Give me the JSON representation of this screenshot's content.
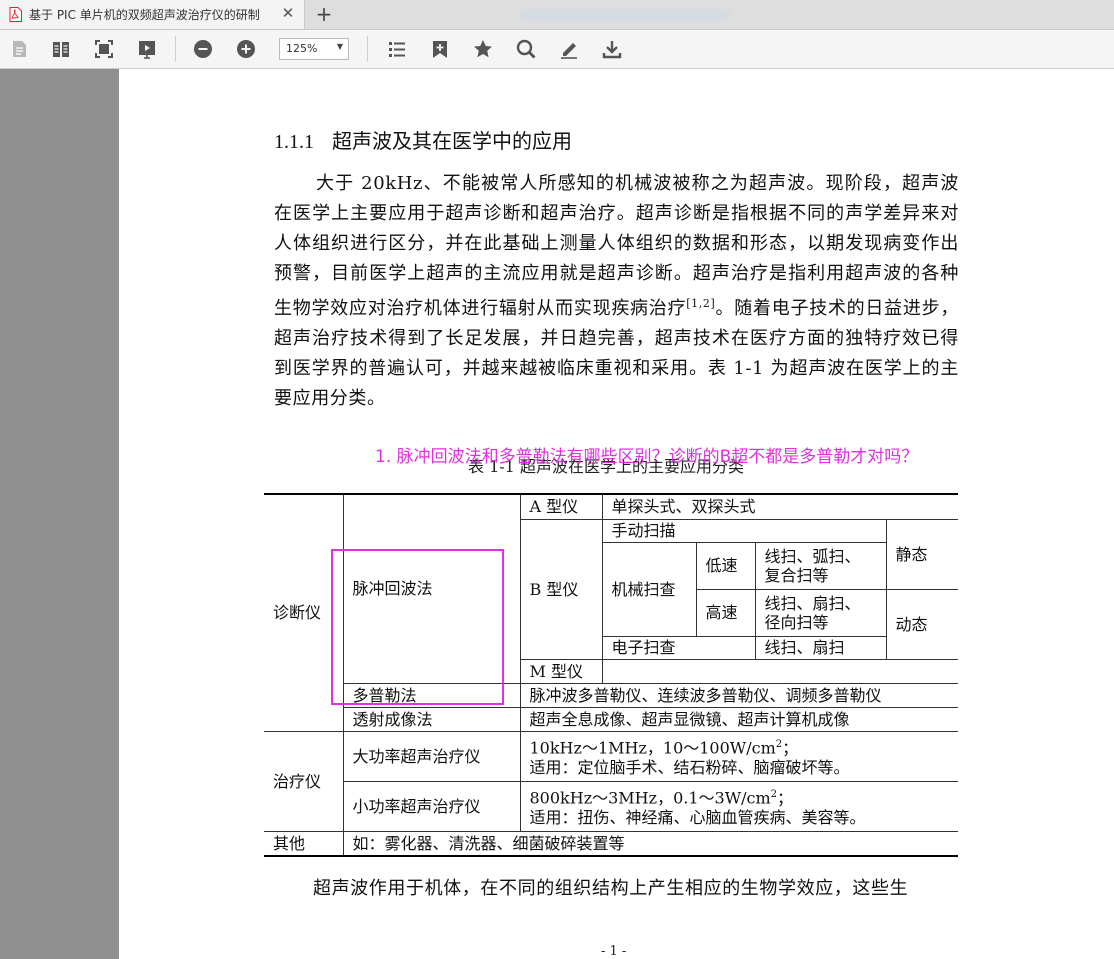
{
  "tab": {
    "title": "基于 PIC 单片机的双频超声波治疗仪的研制",
    "close": "✕",
    "new_tab": "+"
  },
  "toolbar": {
    "zoom": "125%",
    "icons": [
      "page-icon",
      "two-page-icon",
      "fit-page-icon",
      "presentation-icon",
      "zoom-out-icon",
      "zoom-in-icon",
      "outline-list-icon",
      "add-bookmark-icon",
      "star-icon",
      "search-icon",
      "annotate-pen-icon",
      "download-icon"
    ]
  },
  "doc": {
    "heading_num": "1.1.1",
    "heading_text": "超声波及其在医学中的应用",
    "para1_a": "大于 20kHz、不能被常人所感知的机械波被称之为超声波。现阶段，超声波在医学上主要应用于超声诊断和超声治疗。超声诊断是指根据不同的声学差异来对人体组织进行区分，并在此基础上测量人体组织的数据和形态，以期发现病变作出预警，目前医学上超声的主流应用就是超声诊断。超声治疗是指利用超声波的各种生物学效应对治疗机体进行辐射从而实现疾病治疗",
    "para1_sup": "[1,2]",
    "para1_b": "。随着电子技术的日益进步，超声治疗技术得到了长足发展，并日趋完善，超声技术在医疗方面的独特疗效已得到医学界的普遍认可，并越来越被临床重视和采用。表 1-1 为超声波在医学上的主要应用分类。",
    "annotation": "1. 脉冲回波法和多普勒法有哪些区别？诊断的B超不都是多普勒才对吗？",
    "caption": "表 1-1  超声波在医学上的主要应用分类",
    "para2": "超声波作用于机体，在不同的组织结构上产生相应的生物学效应，这些生",
    "page_number": "- 1 -"
  },
  "table": {
    "diag": "诊断仪",
    "pulse": "脉冲回波法",
    "a_type": "A 型仪",
    "a_desc": "单探头式、双探头式",
    "b_type": "B 型仪",
    "manual": "手动扫描",
    "mech": "机械扫查",
    "low": "低速",
    "low_desc_1": "线扫、弧扫、",
    "low_desc_2": "复合扫等",
    "static": "静态",
    "high": "高速",
    "high_desc_1": "线扫、扇扫、",
    "high_desc_2": "径向扫等",
    "dynamic": "动态",
    "elec": "电子扫查",
    "elec_desc": "线扫、扇扫",
    "m_type": "M 型仪",
    "doppler": "多普勒法",
    "doppler_desc": "脉冲波多普勒仪、连续波多普勒仪、调频多普勒仪",
    "trans": "透射成像法",
    "trans_desc": "超声全息成像、超声显微镜、超声计算机成像",
    "treat": "治疗仪",
    "hp": "大功率超声治疗仪",
    "hp_line1_a": "10kHz～1MHz，10～100W/cm",
    "hp_line1_b": "；",
    "hp_line2": "适用：定位脑手术、结石粉碎、脑瘤破坏等。",
    "lp": "小功率超声治疗仪",
    "lp_line1_a": "800kHz～3MHz，0.1～3W/cm",
    "lp_line1_b": "；",
    "lp_line2": "适用：扭伤、神经痛、心脑血管疾病、美容等。",
    "other": "其他",
    "other_desc": "如：雾化器、清洗器、细菌破碎装置等",
    "sq": "2"
  }
}
